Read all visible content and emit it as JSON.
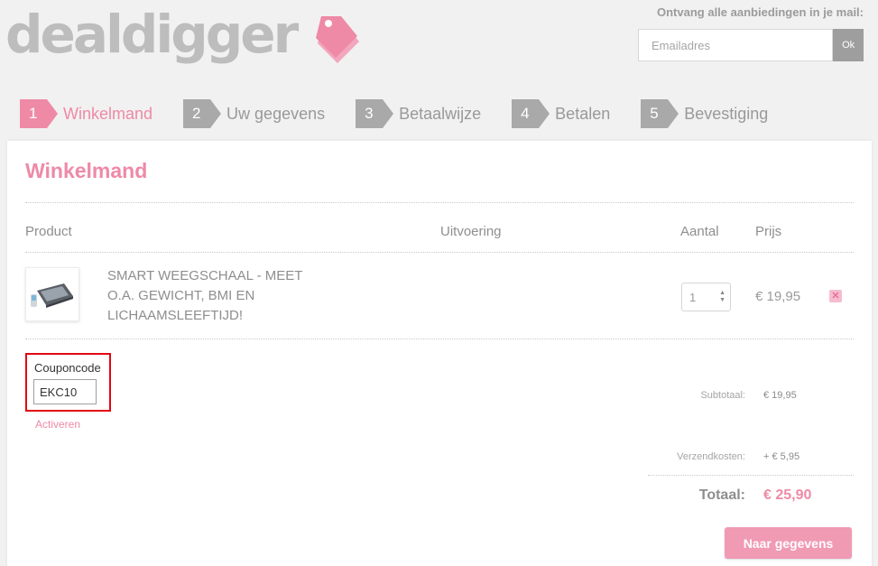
{
  "brand": {
    "name": "dealdigger",
    "accent": "#ee8aa6"
  },
  "newsletter": {
    "label": "Ontvang alle aanbiedingen in je mail:",
    "placeholder": "Emailadres",
    "ok_label": "Ok"
  },
  "steps": [
    {
      "number": "1",
      "label": "Winkelmand",
      "active": true
    },
    {
      "number": "2",
      "label": "Uw gegevens",
      "active": false
    },
    {
      "number": "3",
      "label": "Betaalwijze",
      "active": false
    },
    {
      "number": "4",
      "label": "Betalen",
      "active": false
    },
    {
      "number": "5",
      "label": "Bevestiging",
      "active": false
    }
  ],
  "cart": {
    "title": "Winkelmand",
    "columns": {
      "product": "Product",
      "variant": "Uitvoering",
      "quantity": "Aantal",
      "price": "Prijs"
    },
    "items": [
      {
        "name": "SMART WEEGSCHAAL - MEET O.A. GEWICHT, BMI EN LICHAAMSLEEFTIJD!",
        "quantity": "1",
        "price": "€ 19,95",
        "icon": "scale-icon"
      }
    ],
    "coupon": {
      "label": "Couponcode",
      "value": "EKC10",
      "activate_label": "Activeren"
    },
    "summary": {
      "subtotal_label": "Subtotaal:",
      "subtotal_value": "€ 19,95",
      "shipping_label": "Verzendkosten:",
      "shipping_value": "+ € 5,95",
      "total_label": "Totaal:",
      "total_value": "€ 25,90"
    },
    "next_button": "Naar gegevens"
  }
}
